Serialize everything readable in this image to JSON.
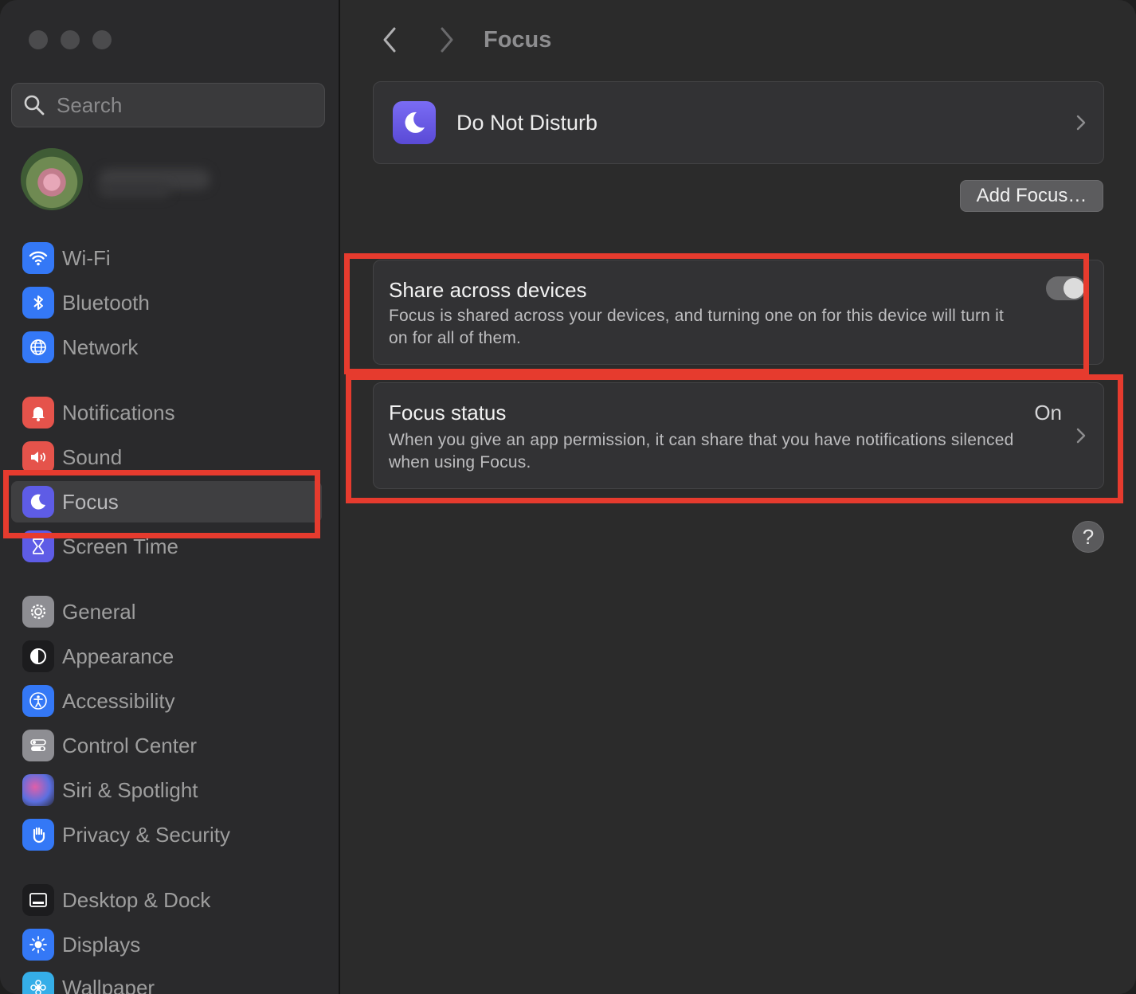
{
  "window": {
    "controls": [
      "close",
      "minimize",
      "zoom"
    ]
  },
  "sidebar": {
    "search": {
      "placeholder": "Search",
      "icon": "search-icon"
    },
    "profile": {
      "avatar": "lotus-flower-avatar",
      "name_redacted": true
    },
    "items": [
      {
        "label": "Wi-Fi",
        "icon": "wifi-icon",
        "color": "#3478f6",
        "active": false
      },
      {
        "label": "Bluetooth",
        "icon": "bluetooth-icon",
        "color": "#3478f6",
        "active": false
      },
      {
        "label": "Network",
        "icon": "globe-icon",
        "color": "#3478f6",
        "active": false
      },
      {
        "label": "Notifications",
        "icon": "bell-icon",
        "color": "#e5534b",
        "active": false
      },
      {
        "label": "Sound",
        "icon": "speaker-icon",
        "color": "#e5534b",
        "active": false
      },
      {
        "label": "Focus",
        "icon": "moon-icon",
        "color": "#5e5ce6",
        "active": true
      },
      {
        "label": "Screen Time",
        "icon": "hourglass-icon",
        "color": "#5e5ce6",
        "active": false
      },
      {
        "label": "General",
        "icon": "gear-icon",
        "color": "#8e8e93",
        "active": false
      },
      {
        "label": "Appearance",
        "icon": "appearance-icon",
        "color": "#1c1c1e",
        "active": false
      },
      {
        "label": "Accessibility",
        "icon": "accessibility-icon",
        "color": "#3478f6",
        "active": false
      },
      {
        "label": "Control Center",
        "icon": "toggles-icon",
        "color": "#8e8e93",
        "active": false
      },
      {
        "label": "Siri & Spotlight",
        "icon": "siri-icon",
        "color": "#6d5bd0",
        "active": false
      },
      {
        "label": "Privacy & Security",
        "icon": "hand-icon",
        "color": "#3478f6",
        "active": false
      },
      {
        "label": "Desktop & Dock",
        "icon": "dock-icon",
        "color": "#1c1c1e",
        "active": false
      },
      {
        "label": "Displays",
        "icon": "sun-icon",
        "color": "#3478f6",
        "active": false
      },
      {
        "label": "Wallpaper",
        "icon": "flower-icon",
        "color": "#35aee8",
        "active": false
      }
    ]
  },
  "toolbar": {
    "back_icon": "chevron-left-icon",
    "forward_icon": "chevron-right-icon",
    "title": "Focus"
  },
  "main": {
    "focus_modes": [
      {
        "label": "Do Not Disturb",
        "icon": "moon-icon",
        "color": "#6a5cf0"
      }
    ],
    "add_focus_label": "Add Focus…",
    "share_across_devices": {
      "title": "Share across devices",
      "description": "Focus is shared across your devices, and turning one on for this device will turn it on for all of them.",
      "enabled": true
    },
    "focus_status": {
      "title": "Focus status",
      "value": "On",
      "description": "When you give an app permission, it can share that you have notifications silenced when using Focus."
    },
    "help_label": "?"
  },
  "annotations": {
    "highlight_color": "#e63b2e"
  }
}
